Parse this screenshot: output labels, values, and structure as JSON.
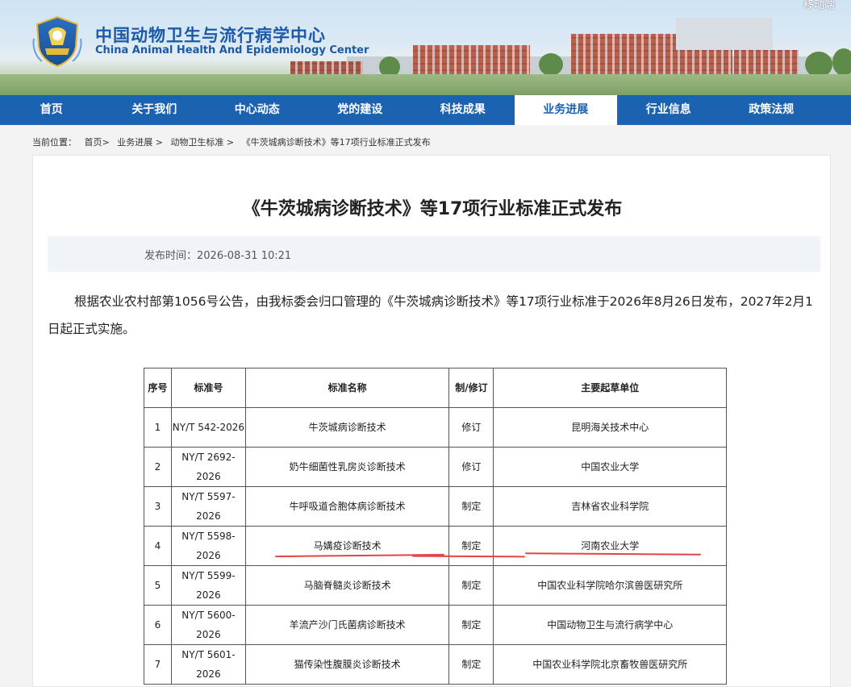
{
  "header": {
    "mobile_link": "移动端",
    "logo_cn": "中国动物卫生与流行病学中心",
    "logo_en": "China Animal Health And Epidemiology Center"
  },
  "nav": {
    "items": [
      {
        "label": "首页"
      },
      {
        "label": "关于我们"
      },
      {
        "label": "中心动态"
      },
      {
        "label": "党的建设"
      },
      {
        "label": "科技成果"
      },
      {
        "label": "业务进展"
      },
      {
        "label": "行业信息"
      },
      {
        "label": "政策法规"
      }
    ],
    "active_index": 5
  },
  "breadcrumb": {
    "prefix": "当前位置：",
    "items": [
      "首页>",
      "业务进展 >",
      "动物卫生标准 >",
      "《牛茨城病诊断技术》等17项行业标准正式发布"
    ]
  },
  "article": {
    "title": "《牛茨城病诊断技术》等17项行业标准正式发布",
    "publish_label": "发布时间：",
    "publish_time": "2026-08-31 10:21",
    "paragraph": "根据农业农村部第1056号公告，由我标委会归口管理的《牛茨城病诊断技术》等17项行业标准于2026年8月26日发布，2027年2月1日起正式实施。"
  },
  "table": {
    "headers": [
      "序号",
      "标准号",
      "标准名称",
      "制/修订",
      "主要起草单位"
    ],
    "rows": [
      [
        "1",
        "NY/T 542-2026",
        "牛茨城病诊断技术",
        "修订",
        "昆明海关技术中心"
      ],
      [
        "2",
        "NY/T 2692-2026",
        "奶牛细菌性乳房炎诊断技术",
        "修订",
        "中国农业大学"
      ],
      [
        "3",
        "NY/T 5597-2026",
        "牛呼吸道合胞体病诊断技术",
        "制定",
        "吉林省农业科学院"
      ],
      [
        "4",
        "NY/T 5598-2026",
        "马媾疫诊断技术",
        "制定",
        "河南农业大学"
      ],
      [
        "5",
        "NY/T 5599-2026",
        "马脑脊髓炎诊断技术",
        "制定",
        "中国农业科学院哈尔滨兽医研究所"
      ],
      [
        "6",
        "NY/T 5600-2026",
        "羊流产沙门氏菌病诊断技术",
        "制定",
        "中国动物卫生与流行病学中心"
      ],
      [
        "7",
        "NY/T 5601-2026",
        "猫传染性腹膜炎诊断技术",
        "制定",
        "中国农业科学院北京畜牧兽医研究所"
      ]
    ]
  },
  "colors": {
    "nav_bg": "#1b62b0",
    "brand_text": "#1a5aa8",
    "highlight_line": "#e34444"
  }
}
